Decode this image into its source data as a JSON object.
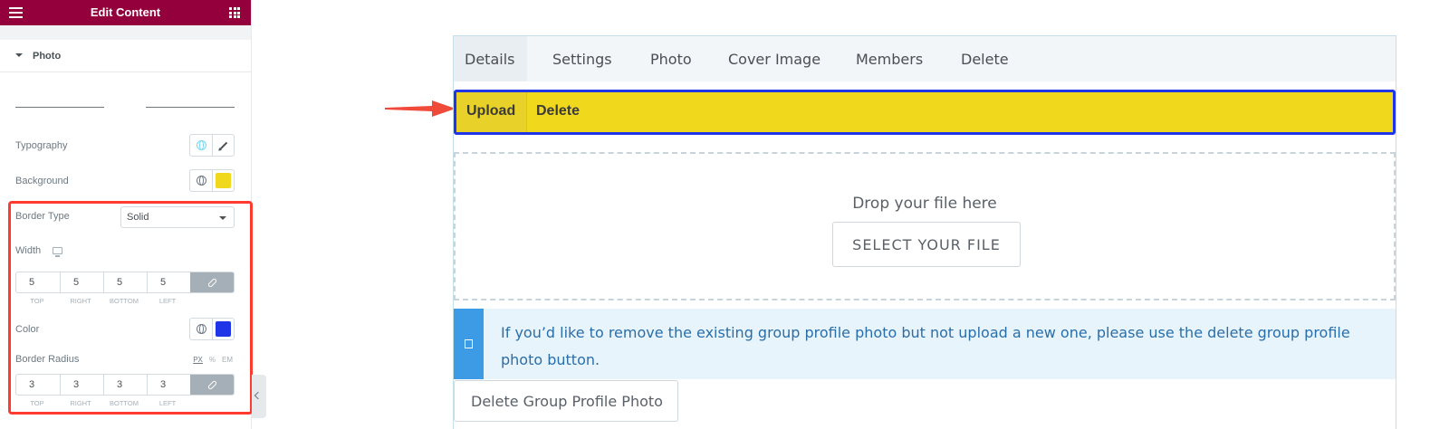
{
  "editor": {
    "header_title": "Edit Content",
    "section_title": "Photo",
    "typography_label": "Typography",
    "background_label": "Background",
    "background_color": "#f0d81d",
    "border_type_label": "Border Type",
    "border_type_value": "Solid",
    "width_label": "Width",
    "width_values": [
      "5",
      "5",
      "5",
      "5"
    ],
    "dim_labels": [
      "TOP",
      "RIGHT",
      "BOTTOM",
      "LEFT"
    ],
    "color_label": "Color",
    "border_color": "#2035e8",
    "radius_label": "Border Radius",
    "units": [
      "PX",
      "%",
      "EM"
    ],
    "radius_values": [
      "3",
      "3",
      "3",
      "3"
    ],
    "accent_color": "#93003c",
    "highlight_color": "#ff3b30"
  },
  "preview": {
    "tabs": [
      "Details",
      "Settings",
      "Photo",
      "Cover Image",
      "Members",
      "Delete"
    ],
    "subnav": [
      "Upload",
      "Delete"
    ],
    "drop_text": "Drop your file here",
    "select_file": "SELECT YOUR FILE",
    "notice": "If you’d like to remove the existing group profile photo but not upload a new one, please use the delete group profile photo button.",
    "delete_button": "Delete Group Profile Photo"
  }
}
